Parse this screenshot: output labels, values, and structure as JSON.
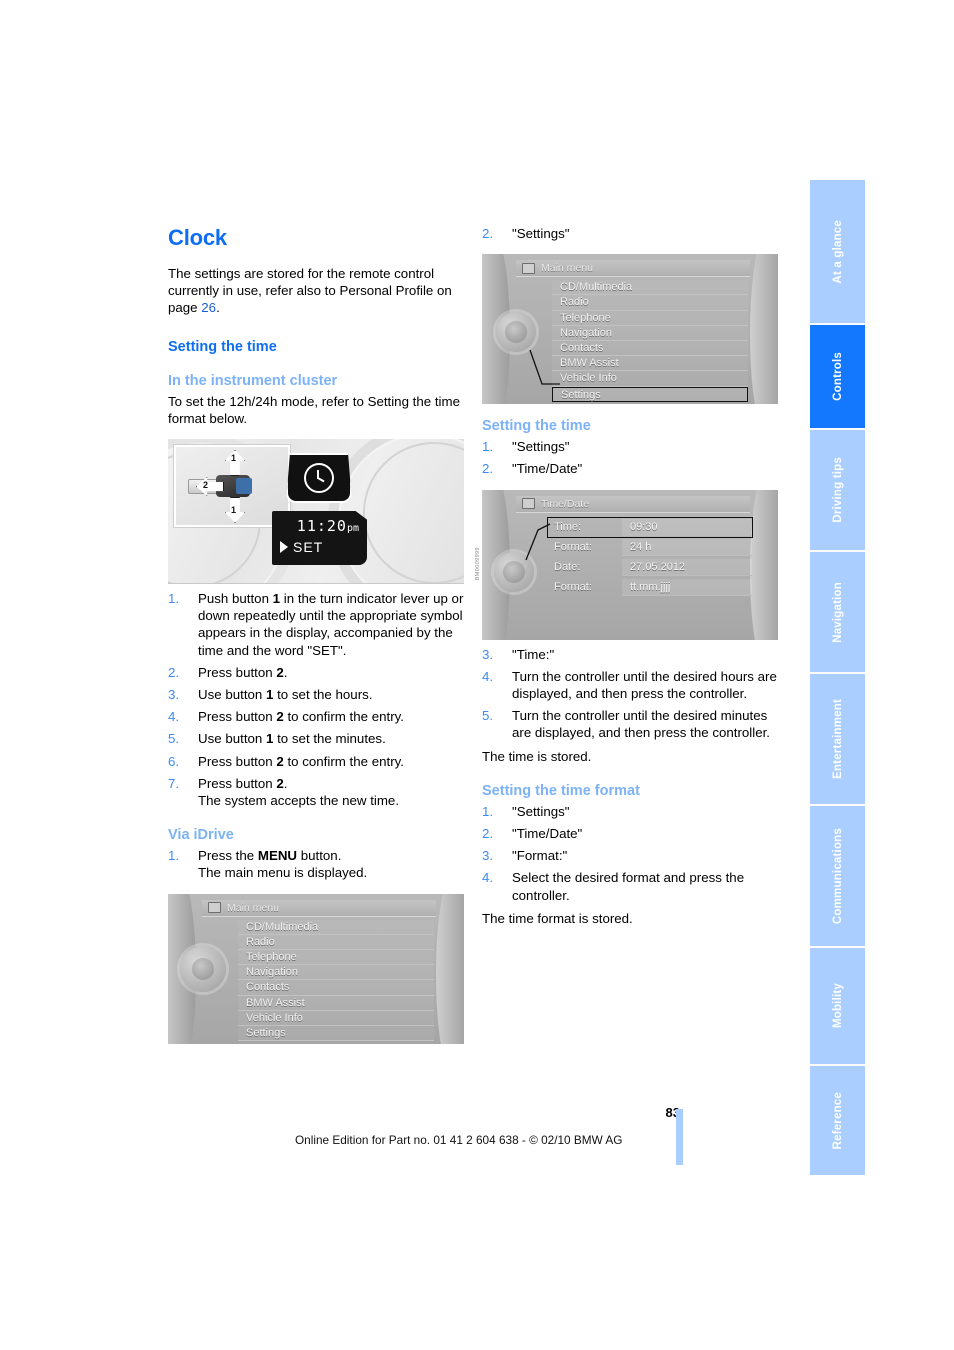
{
  "chapter_title": "Clock",
  "intro": {
    "line1": "The settings are stored for the remote control",
    "line2": "currently in use, refer also to Personal Profile on",
    "line3_prefix": "page ",
    "page_ref": "26",
    "line3_suffix": "."
  },
  "left": {
    "h_setting_time": "Setting the time",
    "h_instrument_cluster": "In the instrument cluster",
    "cluster_intro": "To set the 12h/24h mode, refer to Setting the time format below.",
    "cluster_figure": {
      "arrow_up_label": "1",
      "arrow_down_label": "1",
      "arrow_left_label": "2",
      "display_time": "11:20",
      "display_ampm": "pm",
      "display_set": "SET",
      "figure_code": "BM0009999"
    },
    "steps": [
      {
        "num": "1.",
        "text": "Push button 1 in the turn indicator lever up or down repeatedly until the appropriate symbol appears in the display, accompanied by the time and the word \"SET\"."
      },
      {
        "num": "2.",
        "text": "Press button 2."
      },
      {
        "num": "3.",
        "text": "Use button 1 to set the hours."
      },
      {
        "num": "4.",
        "text": "Press button 2 to confirm the entry."
      },
      {
        "num": "5.",
        "text": "Use button 1 to set the minutes."
      },
      {
        "num": "6.",
        "text": "Press button 2 to confirm the entry."
      },
      {
        "num": "7.",
        "text": "Press button 2.\nThe system accepts the new time."
      }
    ],
    "h_via_idrive": "Via iDrive",
    "idrive_step1_num": "1.",
    "idrive_step1_line1": "Press the MENU button.",
    "idrive_step1_line2": "The main menu is displayed.",
    "main_menu": {
      "title": "Main menu",
      "items": [
        "CD/Multimedia",
        "Radio",
        "Telephone",
        "Navigation",
        "Contacts",
        "BMW Assist",
        "Vehicle Info",
        "Settings"
      ],
      "selected": ""
    }
  },
  "right": {
    "step2_num": "2.",
    "step2_text": "\"Settings\"",
    "main_menu": {
      "title": "Main menu",
      "items": [
        "CD/Multimedia",
        "Radio",
        "Telephone",
        "Navigation",
        "Contacts",
        "BMW Assist",
        "Vehicle Info",
        "Settings"
      ],
      "selected": "Settings"
    },
    "h_setting_time": "Setting the time",
    "time_steps_a": [
      {
        "num": "1.",
        "text": "\"Settings\""
      },
      {
        "num": "2.",
        "text": "\"Time/Date\""
      }
    ],
    "time_date_screen": {
      "title": "Time/Date",
      "rows": [
        {
          "label": "Time:",
          "value": "09:30",
          "selected": true
        },
        {
          "label": "Format:",
          "value": "24 h",
          "selected": false
        },
        {
          "label": "Date:",
          "value": "27.05.2012",
          "selected": false
        },
        {
          "label": "Format:",
          "value": "tt.mm.jjjj",
          "selected": false
        }
      ]
    },
    "time_steps_b": [
      {
        "num": "3.",
        "text": "\"Time:\""
      },
      {
        "num": "4.",
        "text": "Turn the controller until the desired hours are displayed, and then press the controller."
      },
      {
        "num": "5.",
        "text": "Turn the controller until the desired minutes are displayed, and then press the controller."
      }
    ],
    "time_stored": "The time is stored.",
    "h_time_format": "Setting the time format",
    "format_steps": [
      {
        "num": "1.",
        "text": "\"Settings\""
      },
      {
        "num": "2.",
        "text": "\"Time/Date\""
      },
      {
        "num": "3.",
        "text": "\"Format:\""
      },
      {
        "num": "4.",
        "text": "Select the desired format and press the controller."
      }
    ],
    "format_stored": "The time format is stored."
  },
  "tabs": [
    {
      "label": "At a glance",
      "active": false
    },
    {
      "label": "Controls",
      "active": true
    },
    {
      "label": "Driving tips",
      "active": false
    },
    {
      "label": "Navigation",
      "active": false
    },
    {
      "label": "Entertainment",
      "active": false
    },
    {
      "label": "Communications",
      "active": false
    },
    {
      "label": "Mobility",
      "active": false
    },
    {
      "label": "Reference",
      "active": false
    }
  ],
  "footer": {
    "page_number": "83",
    "edition_line": "Online Edition for Part no. 01 41 2 604 638 - © 02/10 BMW AG"
  },
  "colors": {
    "accent_blue": "#0d6ef5",
    "light_blue": "#7cb2f7",
    "tab_blue": "#a9ceff",
    "tab_active": "#1478ff"
  }
}
